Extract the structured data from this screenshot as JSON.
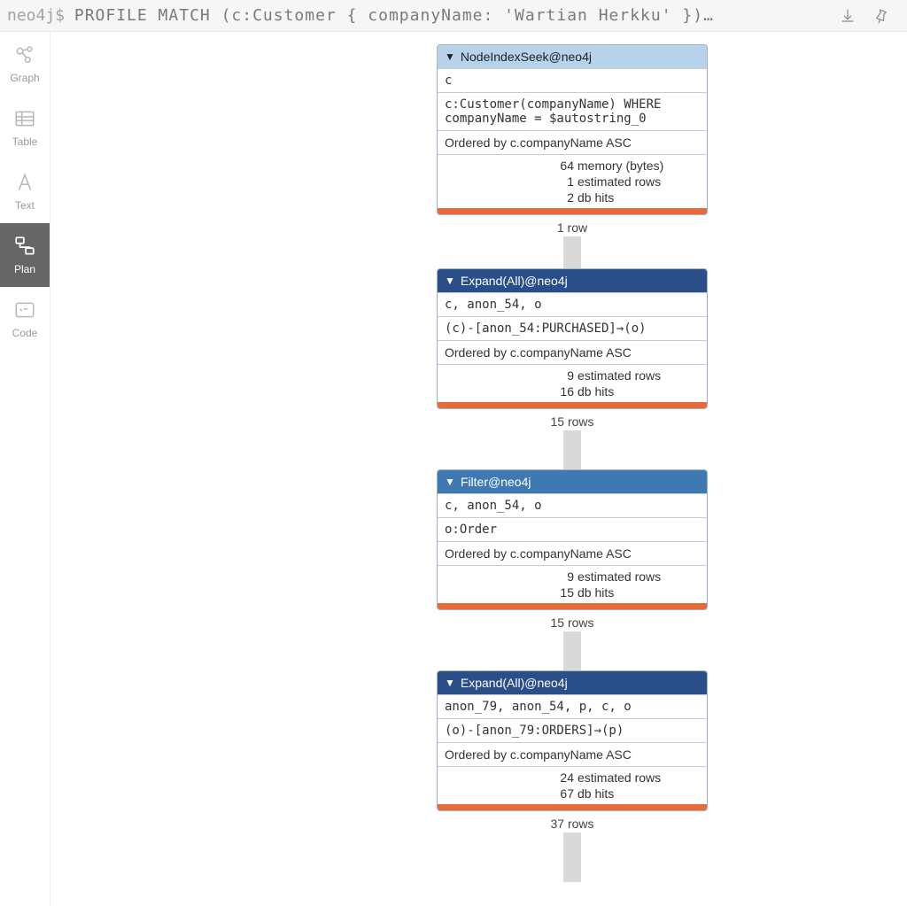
{
  "topbar": {
    "prompt_prefix": "neo4j$ ",
    "query": "PROFILE MATCH (c:Customer { companyName: 'Wartian Herkku' })…"
  },
  "sidebar": {
    "items": [
      {
        "label": "Graph"
      },
      {
        "label": "Table"
      },
      {
        "label": "Text"
      },
      {
        "label": "Plan"
      },
      {
        "label": "Code"
      }
    ]
  },
  "plan": {
    "operators": [
      {
        "title": "NodeIndexSeek@neo4j",
        "header_style": "light",
        "identifiers": "c",
        "detail": "c:Customer(companyName) WHERE companyName = $autostring_0",
        "order": "Ordered by c.companyName ASC",
        "stats": [
          {
            "num": "64",
            "lbl": "memory (bytes)"
          },
          {
            "num": "1",
            "lbl": "estimated rows"
          },
          {
            "num": "2",
            "lbl": "db hits"
          }
        ],
        "outflow": "1 row",
        "conn_height": 36
      },
      {
        "title": "Expand(All)@neo4j",
        "header_style": "dark",
        "identifiers": "c, anon_54, o",
        "detail": "(c)-[anon_54:PURCHASED]→(o)",
        "order": "Ordered by c.companyName ASC",
        "stats": [
          {
            "num": "9",
            "lbl": "estimated rows"
          },
          {
            "num": "16",
            "lbl": "db hits"
          }
        ],
        "outflow": "15 rows",
        "conn_height": 44
      },
      {
        "title": "Filter@neo4j",
        "header_style": "mid",
        "identifiers": "c, anon_54, o",
        "detail": "o:Order",
        "order": "Ordered by c.companyName ASC",
        "stats": [
          {
            "num": "9",
            "lbl": "estimated rows"
          },
          {
            "num": "15",
            "lbl": "db hits"
          }
        ],
        "outflow": "15 rows",
        "conn_height": 44
      },
      {
        "title": "Expand(All)@neo4j",
        "header_style": "dark",
        "identifiers": "anon_79, anon_54, p, c, o",
        "detail": "(o)-[anon_79:ORDERS]→(p)",
        "order": "Ordered by c.companyName ASC",
        "stats": [
          {
            "num": "24",
            "lbl": "estimated rows"
          },
          {
            "num": "67",
            "lbl": "db hits"
          }
        ],
        "outflow": "37 rows",
        "conn_height": 56
      }
    ]
  }
}
